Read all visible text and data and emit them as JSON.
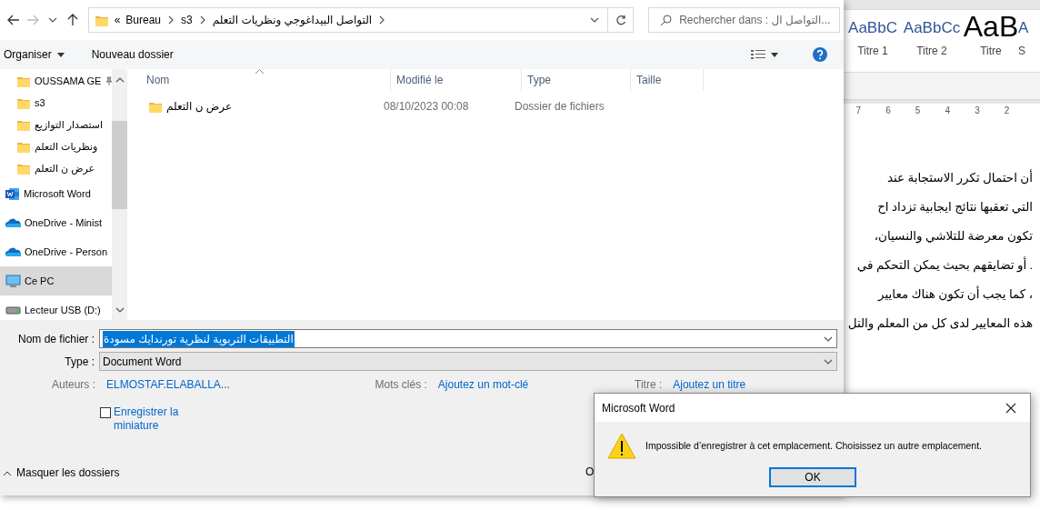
{
  "word": {
    "styles": [
      {
        "sample": "AaBbC",
        "label": "Titre 1",
        "kind": "heading"
      },
      {
        "sample": "AaBbCc",
        "label": "Titre 2",
        "kind": "heading"
      },
      {
        "sample": "AaB",
        "label": "Titre",
        "kind": "title"
      },
      {
        "sample": "A",
        "label": "S",
        "kind": "heading"
      }
    ],
    "ruler": [
      "7",
      "6",
      "5",
      "4",
      "3",
      "2"
    ],
    "lines": [
      "أن احتمال تكرر الاستجابة عند",
      "التي تعقبها نتائج ايجابية تزداد اح",
      "تكون معرضة للتلاشي والنسيان،",
      ". أو تضايقهم بحيث يمكن التحكم في",
      "، كما يجب أن تكون هناك معايير",
      "هذه المعايير لدى كل من المعلم والتل"
    ]
  },
  "save_dialog": {
    "forward_disabled": true,
    "breadcrumb": [
      "«",
      "Bureau",
      "s3",
      "التواصل البيداغوجي ونظريات التعلم"
    ],
    "search": {
      "placeholder": "Rechercher dans : التواصل ال..."
    },
    "toolbar": {
      "organize": "Organiser",
      "new_folder": "Nouveau dossier"
    },
    "sidebar": [
      {
        "label": "OUSSAMA GE",
        "kind": "folder",
        "pinned": true,
        "selected": false
      },
      {
        "label": "s3",
        "kind": "folder",
        "pinned": false,
        "selected": false
      },
      {
        "label": "استصدار التوازيع",
        "kind": "folder",
        "pinned": false,
        "selected": false
      },
      {
        "label": "ونظريات التعلم",
        "kind": "folder",
        "pinned": false,
        "selected": false
      },
      {
        "label": "عرض ن التعلم",
        "kind": "folder",
        "pinned": false,
        "selected": false
      },
      {
        "label": "Microsoft Word",
        "kind": "word",
        "pinned": false,
        "selected": false
      },
      {
        "label": "OneDrive - Minist",
        "kind": "cloud",
        "pinned": false,
        "selected": false
      },
      {
        "label": "OneDrive - Person",
        "kind": "cloud",
        "pinned": false,
        "selected": false
      },
      {
        "label": "Ce PC",
        "kind": "pc",
        "pinned": false,
        "selected": true
      },
      {
        "label": "Lecteur USB (D:)",
        "kind": "usb",
        "pinned": false,
        "selected": false
      }
    ],
    "columns": [
      "Nom",
      "Modifié le",
      "Type",
      "Taille"
    ],
    "rows": [
      {
        "name": "عرض ن التعلم",
        "modified": "08/10/2023 00:08",
        "type": "Dossier de fichiers"
      }
    ],
    "filename": {
      "label": "Nom de fichier :",
      "value": "التطبيقات التربوية لنظرية تورندايك مسودة"
    },
    "file_type": {
      "label": "Type :",
      "value": "Document Word"
    },
    "metadata": [
      {
        "label": "Auteurs :",
        "value": "ELMOSTAF.ELABALLA..."
      },
      {
        "label": "Mots clés :",
        "value": "Ajoutez un mot-clé"
      },
      {
        "label": "Titre :",
        "value": "Ajoutez un titre"
      }
    ],
    "thumbnail": {
      "label": "Enregistrer la miniature",
      "checked": false
    },
    "hide_folders": "Masquer les dossiers",
    "hidden_button": "O"
  },
  "message_box": {
    "title": "Microsoft Word",
    "message": "Impossible d’enregistrer à cet emplacement. Choisissez un autre emplacement.",
    "button": "OK"
  }
}
